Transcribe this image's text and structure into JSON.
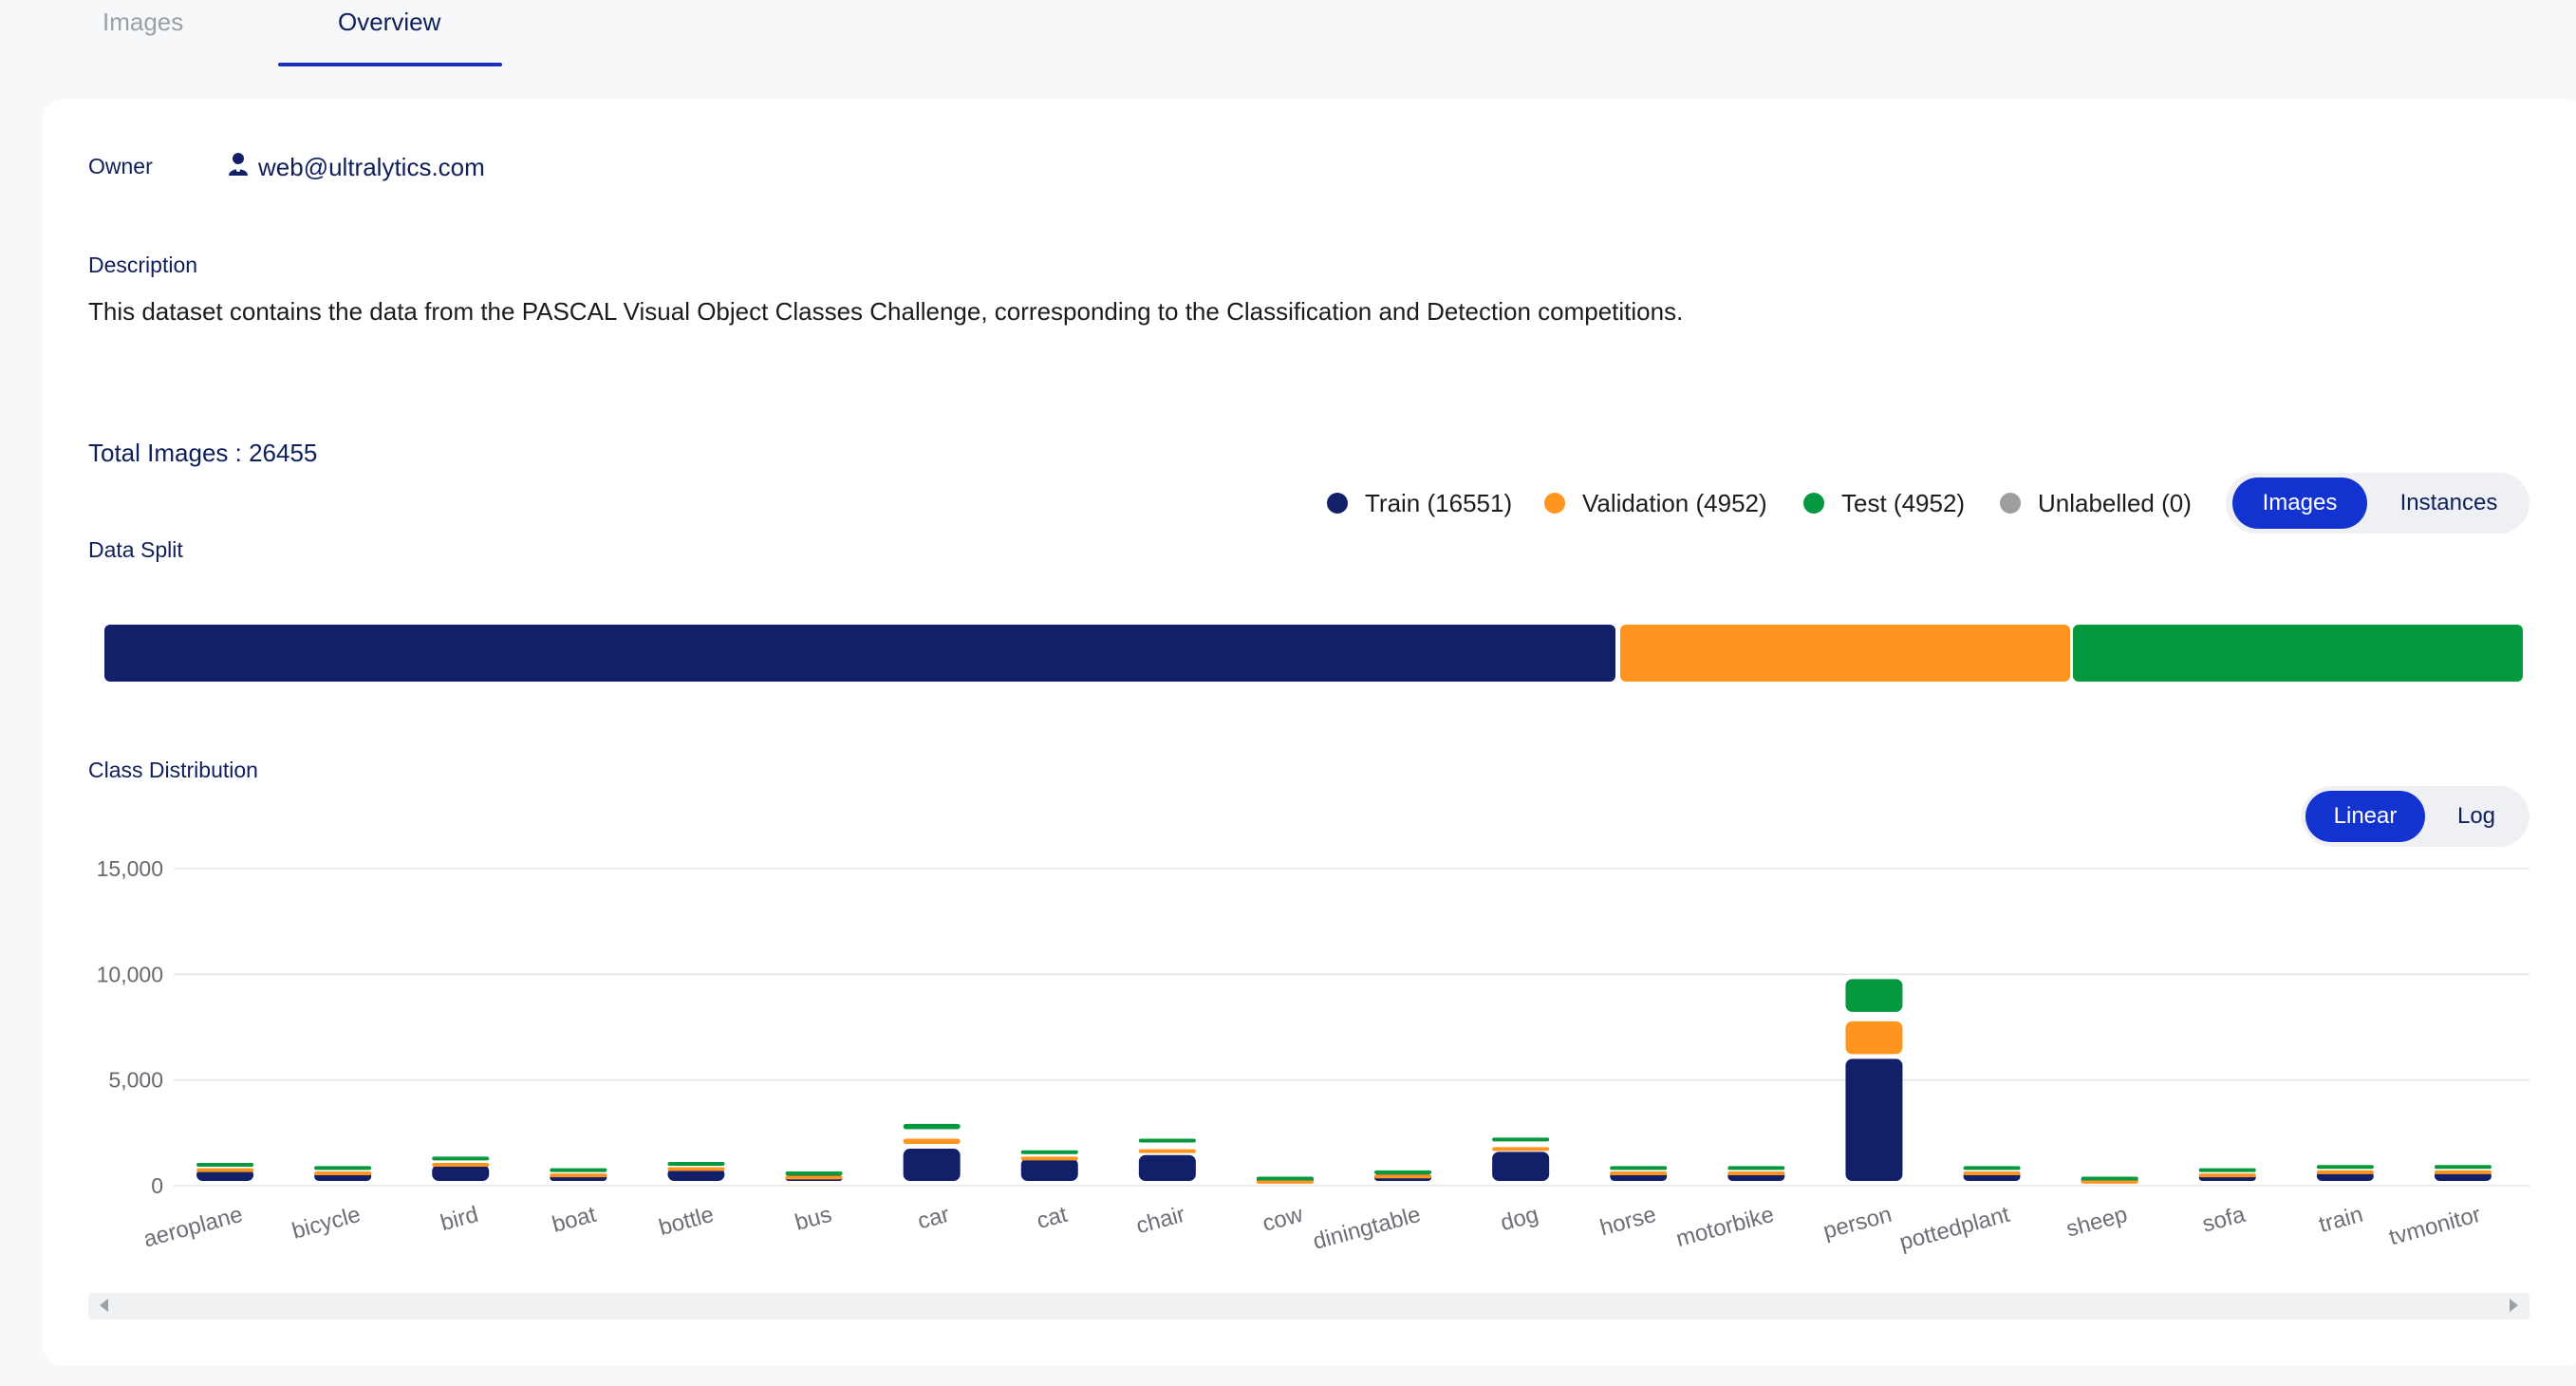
{
  "tabs": [
    {
      "label": "Images",
      "active": false
    },
    {
      "label": "Overview",
      "active": true
    }
  ],
  "owner": {
    "label": "Owner",
    "value": "web@ultralytics.com"
  },
  "description": {
    "label": "Description",
    "text": "This dataset contains the data from the PASCAL Visual Object Classes Challenge, corresponding to the Classification and Detection competitions."
  },
  "total_images": "Total Images : 26455",
  "legend": [
    {
      "label": "Train (16551)",
      "color": "#12206a"
    },
    {
      "label": "Validation (4952)",
      "color": "#ff951e"
    },
    {
      "label": "Test (4952)",
      "color": "#04993f"
    },
    {
      "label": "Unlabelled (0)",
      "color": "#9e9e9e"
    }
  ],
  "mode_toggle": {
    "options": [
      "Images",
      "Instances"
    ],
    "selected": "Images"
  },
  "data_split": {
    "label": "Data Split",
    "segments": [
      {
        "name": "Train",
        "value": 16551,
        "color": "#12206a"
      },
      {
        "name": "Validation",
        "value": 4952,
        "color": "#ff951e"
      },
      {
        "name": "Test",
        "value": 4952,
        "color": "#04993f"
      }
    ]
  },
  "class_distribution": {
    "label": "Class Distribution"
  },
  "scale_toggle": {
    "options": [
      "Linear",
      "Log"
    ],
    "selected": "Linear"
  },
  "chart_data": {
    "type": "bar",
    "stacked": true,
    "ylim": [
      0,
      15000
    ],
    "yticks": [
      0,
      5000,
      10000,
      15000
    ],
    "ytick_labels": [
      "0",
      "5,000",
      "10,000",
      "15,000"
    ],
    "grid": true,
    "categories": [
      "aeroplane",
      "bicycle",
      "bird",
      "boat",
      "bottle",
      "bus",
      "car",
      "cat",
      "chair",
      "cow",
      "diningtable",
      "dog",
      "horse",
      "motorbike",
      "person",
      "pottedplant",
      "sheep",
      "sofa",
      "train",
      "tvmonitor"
    ],
    "series": [
      {
        "name": "Train",
        "color": "#12206a",
        "values": [
          800,
          650,
          1000,
          550,
          850,
          500,
          1750,
          1300,
          1450,
          350,
          550,
          1600,
          650,
          650,
          6000,
          650,
          350,
          550,
          700,
          700
        ]
      },
      {
        "name": "Validation",
        "color": "#ff951e",
        "values": [
          250,
          250,
          300,
          250,
          250,
          200,
          700,
          300,
          500,
          150,
          200,
          450,
          250,
          250,
          2000,
          250,
          150,
          250,
          250,
          250
        ]
      },
      {
        "name": "Test",
        "color": "#04993f",
        "values": [
          250,
          250,
          300,
          250,
          250,
          200,
          700,
          300,
          500,
          150,
          200,
          450,
          250,
          250,
          2000,
          250,
          150,
          250,
          250,
          250
        ]
      }
    ]
  }
}
